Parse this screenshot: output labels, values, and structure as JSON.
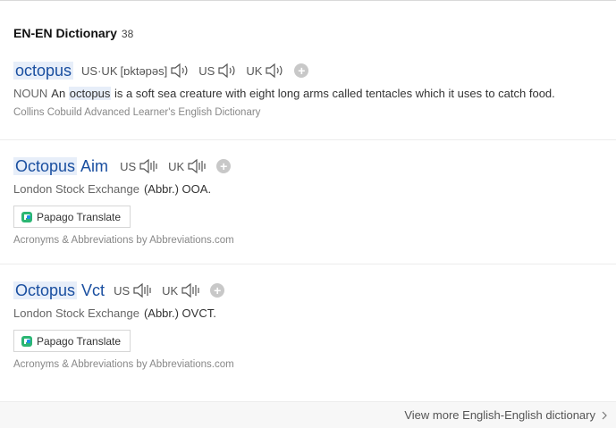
{
  "section": {
    "title": "EN-EN Dictionary",
    "count": "38"
  },
  "entries": [
    {
      "headword": "octopus",
      "pron_both": "US·UK",
      "ipa": "[ɒktəpəs]",
      "pron_us": "US",
      "pron_uk": "UK",
      "pos": "NOUN",
      "def_before": "An ",
      "def_hl": "octopus",
      "def_after": " is a soft sea creature with eight long arms called tentacles which it uses to catch food.",
      "source": "Collins Cobuild Advanced Learner's English Dictionary"
    },
    {
      "headword_hl": "Octopus",
      "headword_rest": " Aim",
      "pron_us": "US",
      "pron_uk": "UK",
      "subject": "London Stock Exchange",
      "abbr": "(Abbr.) OOA.",
      "translate_label": "Papago Translate",
      "source": "Acronyms & Abbreviations by Abbreviations.com"
    },
    {
      "headword_hl": "Octopus",
      "headword_rest": " Vct",
      "pron_us": "US",
      "pron_uk": "UK",
      "subject": "London Stock Exchange",
      "abbr": "(Abbr.) OVCT.",
      "translate_label": "Papago Translate",
      "source": "Acronyms & Abbreviations by Abbreviations.com"
    }
  ],
  "footer": {
    "more_label": "View more English-English dictionary"
  },
  "icons": {
    "speaker": "speaker-icon",
    "add": "plus-icon",
    "papago": "papago-logo-icon",
    "chevron": "chevron-right-icon"
  },
  "colors": {
    "headword": "#1a4fa0",
    "highlight": "#e7eef9",
    "source": "#888888"
  }
}
